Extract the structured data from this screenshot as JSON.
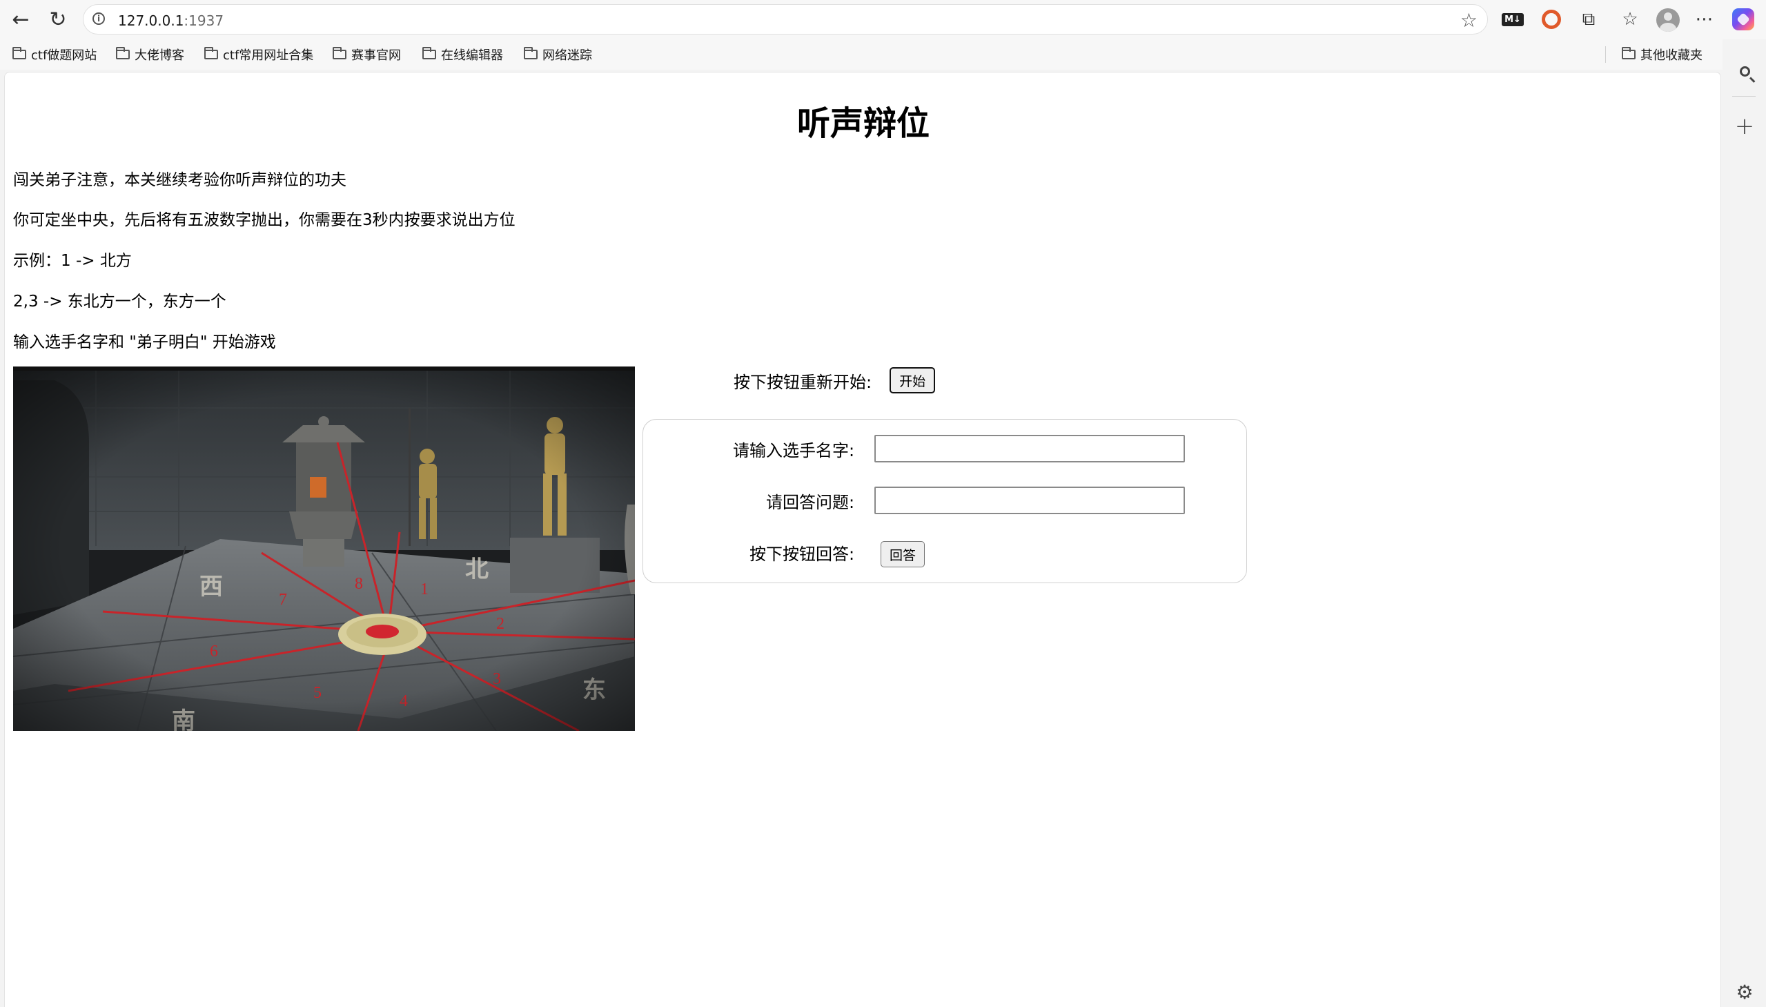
{
  "browser": {
    "url_host": "127.0.0.1",
    "url_port": ":1937",
    "bookmarks": [
      {
        "label": "ctf做题网站"
      },
      {
        "label": "大佬博客"
      },
      {
        "label": "ctf常用网址合集"
      },
      {
        "label": "赛事官网"
      },
      {
        "label": "在线编辑器"
      },
      {
        "label": "网络迷踪"
      }
    ],
    "other_bookmarks": "其他收藏夹",
    "md_badge": "M↓"
  },
  "page": {
    "title": "听声辩位",
    "rules": [
      "闯关弟子注意，本关继续考验你听声辩位的功夫",
      "你可定坐中央，先后将有五波数字抛出，你需要在3秒内按要求说出方位",
      "示例：1 -> 北方",
      "2,3 -> 东北方一个，东方一个",
      "输入选手名字和 \"弟子明白\" 开始游戏"
    ],
    "image_numbers": [
      "1",
      "2",
      "3",
      "4",
      "5",
      "6",
      "7",
      "8"
    ],
    "image_chars": [
      "北",
      "东",
      "南",
      "西"
    ],
    "restart_label": "按下按钮重新开始:",
    "start_button": "开始",
    "form": {
      "name_label": "请输入选手名字:",
      "name_value": "",
      "question_label": "请回答问题:",
      "question_value": "",
      "answer_label": "按下按钮回答:",
      "answer_button": "回答"
    }
  },
  "colors": {
    "red_lines": "#c8242a",
    "floor": "#5e6266",
    "wall": "#4a4f53",
    "statue_gold": "#b59a52"
  }
}
